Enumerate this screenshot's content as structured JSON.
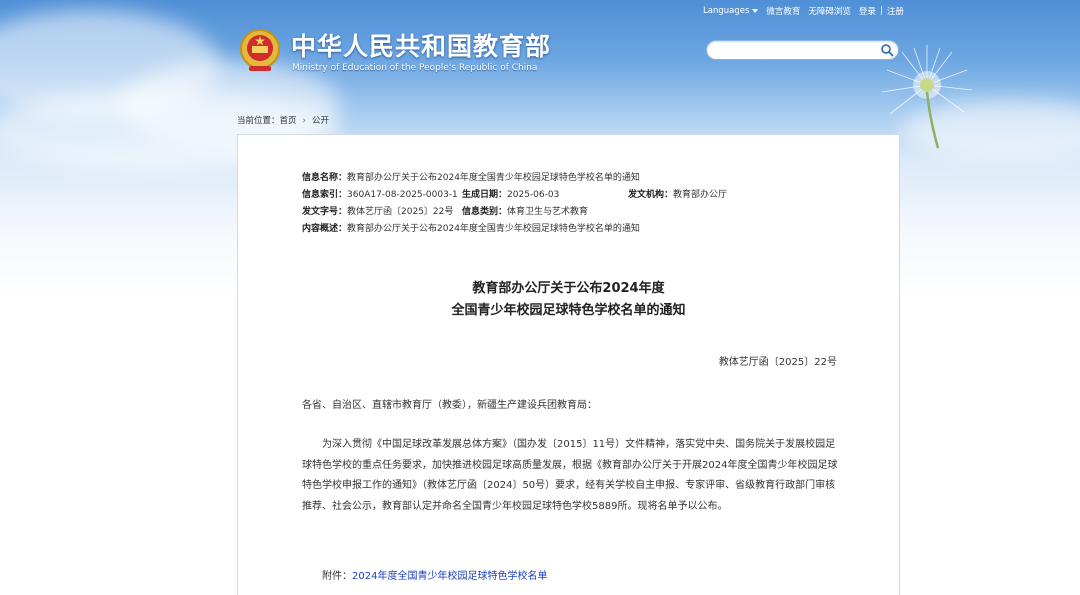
{
  "header": {
    "site_title": "中华人民共和国教育部",
    "site_subtitle": "Ministry of Education of the People's Republic of China",
    "emblem_icon": "national-emblem-icon"
  },
  "toplinks": {
    "languages": "Languages",
    "weibo": "微言教育",
    "accessibility": "无障碍浏览",
    "login": "登录",
    "register": "注册"
  },
  "search": {
    "value": "",
    "icon": "search-icon"
  },
  "breadcrumb": {
    "prefix": "当前位置：",
    "home": "首页",
    "current": "公开"
  },
  "info": {
    "name_label": "信息名称：",
    "name_value": "教育部办公厅关于公布2024年度全国青少年校园足球特色学校名单的通知",
    "index_label": "信息索引：",
    "index_value": "360A17-08-2025-0003-1",
    "date_label": "生成日期：",
    "date_value": "2025-06-03",
    "agency_label": "发文机构：",
    "agency_value": "教育部办公厅",
    "docnum_label": "发文字号：",
    "docnum_value": "教体艺厅函〔2025〕22号",
    "category_label": "信息类别：",
    "category_value": "体育卫生与艺术教育",
    "summary_label": "内容概述：",
    "summary_value": "教育部办公厅关于公布2024年度全国青少年校园足球特色学校名单的通知"
  },
  "article": {
    "title_line1": "教育部办公厅关于公布2024年度",
    "title_line2": "全国青少年校园足球特色学校名单的通知",
    "doc_number": "教体艺厅函〔2025〕22号",
    "salutation": "各省、自治区、直辖市教育厅（教委），新疆生产建设兵团教育局：",
    "body": "为深入贯彻《中国足球改革发展总体方案》（国办发〔2015〕11号）文件精神，落实党中央、国务院关于发展校园足球特色学校的重点任务要求，加快推进校园足球高质量发展，根据《教育部办公厅关于开展2024年度全国青少年校园足球特色学校申报工作的通知》（教体艺厅函〔2024〕50号）要求，经有关学校自主申报、专家评审、省级教育行政部门审核推荐、社会公示，教育部认定并命名全国青少年校园足球特色学校5889所。现将名单予以公布。",
    "attachment_label": "附件：",
    "attachment_link": "2024年度全国青少年校园足球特色学校名单"
  }
}
